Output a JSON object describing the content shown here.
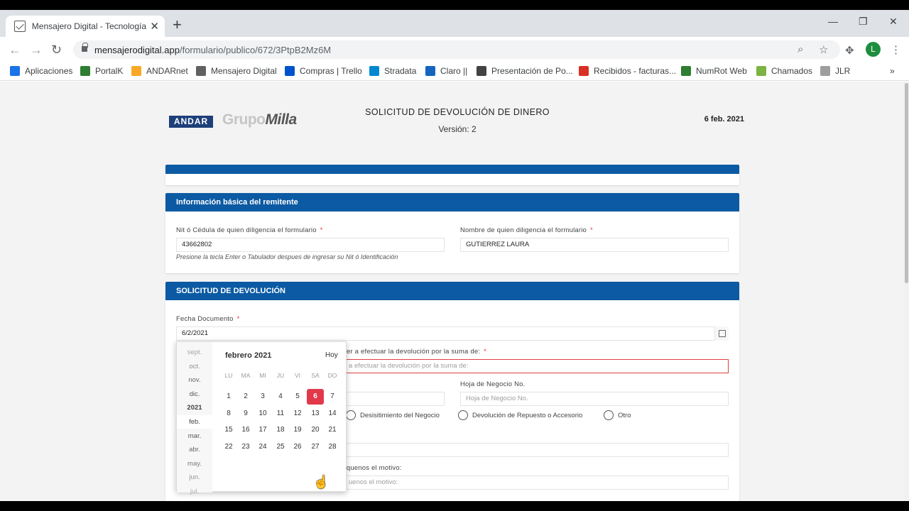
{
  "browser": {
    "tab_title": "Mensajero Digital - Tecnología C",
    "tab_close": "✕",
    "new_tab": "+",
    "window_controls": [
      "—",
      "❐",
      "✕"
    ],
    "url_host": "mensajerodigital.app",
    "url_path": "/formulario/publico/672/3PtpB2Mz6M",
    "avatar_letter": "L",
    "bookmarks": [
      {
        "label": "Aplicaciones",
        "icon": "apps-grid-icon",
        "color": "#1a73e8"
      },
      {
        "label": "PortalK",
        "icon": "portalk-icon",
        "color": "#2e7d32"
      },
      {
        "label": "ANDARnet",
        "icon": "andarnet-icon",
        "color": "#f9a825"
      },
      {
        "label": "Mensajero Digital",
        "icon": "mensajero-icon",
        "color": "#616161"
      },
      {
        "label": "Compras | Trello",
        "icon": "trello-icon",
        "color": "#0052cc"
      },
      {
        "label": "Stradata",
        "icon": "stradata-icon",
        "color": "#0288d1"
      },
      {
        "label": "Claro ||",
        "icon": "claro-icon",
        "color": "#1565c0"
      },
      {
        "label": "Presentación de Po...",
        "icon": "globe-icon",
        "color": "#424242"
      },
      {
        "label": "Recibidos - facturas...",
        "icon": "gmail-icon",
        "color": "#d93025"
      },
      {
        "label": "NumRot Web",
        "icon": "numrot-icon",
        "color": "#2e7d32"
      },
      {
        "label": "Chamados",
        "icon": "chamados-icon",
        "color": "#7cb342"
      },
      {
        "label": "JLR",
        "icon": "jlr-icon",
        "color": "#9e9e9e"
      }
    ],
    "bookmarks_more": "»"
  },
  "header": {
    "logo_andar": "ANDAR",
    "logo_grupo": "Grupo",
    "logo_milla": "Milla",
    "title": "SOLICITUD DE DEVOLUCIÓN DE DINERO",
    "version": "Versión: 2",
    "date": "6 feb. 2021"
  },
  "section_remitente": {
    "title": "Información básica del remitente",
    "nit_label": "Nit ó Cédula de quien diligencia el formulario",
    "nit_value": "43662802",
    "nit_hint": "Presione la tecla Enter o Tabulador despues de ingresar su Nit ó Identificación",
    "nombre_label": "Nombre de quien diligencia el formulario",
    "nombre_value": "GUTIERREZ LAURA",
    "required_mark": "*"
  },
  "section_devolucion": {
    "title": "SOLICITUD DE DEVOLUCIÓN",
    "fecha_label": "Fecha Documento",
    "fecha_value": "6/2/2021",
    "suma_label": "er a efectuar la devolución por la suma de:",
    "suma_placeholder": "a efectuar la devolución por la suma de:",
    "hoja_label": "Hoja de Negocio No.",
    "hoja_placeholder": "Hoja de Negocio No.",
    "radio_options": [
      "Desisitimiento del Negocio",
      "Devolución de Repuesto o Accesorio",
      "Otro"
    ],
    "motivo_label": "íquenos el motivo:",
    "motivo_placeholder": "uenos el motivo:"
  },
  "datepicker": {
    "months": [
      "sept.",
      "oct.",
      "nov.",
      "dic.",
      "2021",
      "feb.",
      "mar.",
      "abr.",
      "may.",
      "jun.",
      "jul."
    ],
    "title": "febrero 2021",
    "today": "Hoy",
    "weekdays": [
      "LU",
      "MA",
      "MI",
      "JU",
      "VI",
      "SA",
      "DO"
    ],
    "weeks": [
      [
        "1",
        "2",
        "3",
        "4",
        "5",
        "6",
        "7"
      ],
      [
        "8",
        "9",
        "10",
        "11",
        "12",
        "13",
        "14"
      ],
      [
        "15",
        "16",
        "17",
        "18",
        "19",
        "20",
        "21"
      ],
      [
        "22",
        "23",
        "24",
        "25",
        "26",
        "27",
        "28"
      ]
    ],
    "selected_day": "6",
    "selected_color": "#e2394a"
  },
  "colors": {
    "section_header": "#0b5aa3",
    "required": "#e53935"
  }
}
